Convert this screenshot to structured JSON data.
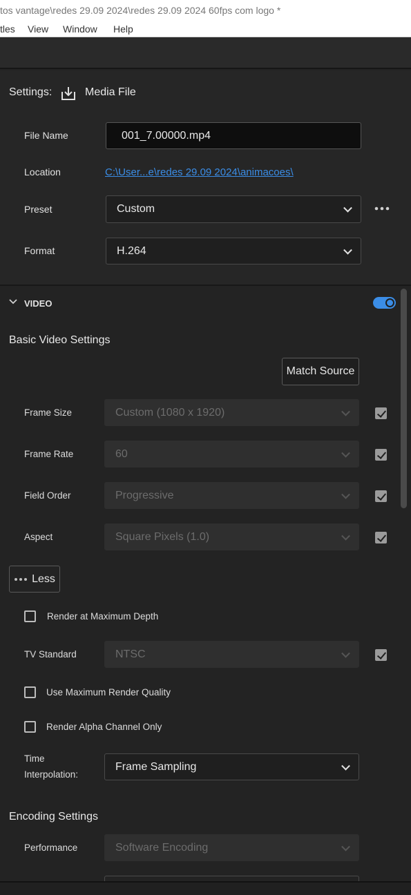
{
  "window": {
    "title": "tos vantage\\redes 29.09 2024\\redes 29.09 2024 60fps com logo *"
  },
  "menu": {
    "items": [
      "tles",
      "View",
      "Window",
      "Help"
    ]
  },
  "settings": {
    "label": "Settings:",
    "media_icon": "download-tray-icon",
    "media_label": "Media File",
    "file_name_label": "File Name",
    "file_name_value": "001_7.00000.mp4",
    "location_label": "Location",
    "location_value": "C:\\User...e\\redes 29.09 2024\\animacoes\\",
    "preset_label": "Preset",
    "preset_value": "Custom",
    "preset_more_icon": "ellipsis-icon",
    "format_label": "Format",
    "format_value": "H.264"
  },
  "video": {
    "section_label": "VIDEO",
    "toggle_on": true,
    "basic_heading": "Basic Video Settings",
    "match_source_label": "Match Source",
    "frame_size_label": "Frame Size",
    "frame_size_value": "Custom (1080 x 1920)",
    "frame_rate_label": "Frame Rate",
    "frame_rate_value": "60",
    "field_order_label": "Field Order",
    "field_order_value": "Progressive",
    "aspect_label": "Aspect",
    "aspect_value": "Square Pixels (1.0)",
    "less_label": "Less",
    "render_max_depth_label": "Render at Maximum Depth",
    "tv_standard_label": "TV Standard",
    "tv_standard_value": "NTSC",
    "max_render_quality_label": "Use Maximum Render Quality",
    "render_alpha_label": "Render Alpha Channel Only",
    "time_interp_label_line1": "Time",
    "time_interp_label_line2": "Interpolation:",
    "time_interp_value": "Frame Sampling"
  },
  "encoding": {
    "heading": "Encoding Settings",
    "performance_label": "Performance",
    "performance_value": "Software Encoding"
  },
  "colors": {
    "accent": "#3b8de6",
    "panel_bg": "#232323"
  }
}
